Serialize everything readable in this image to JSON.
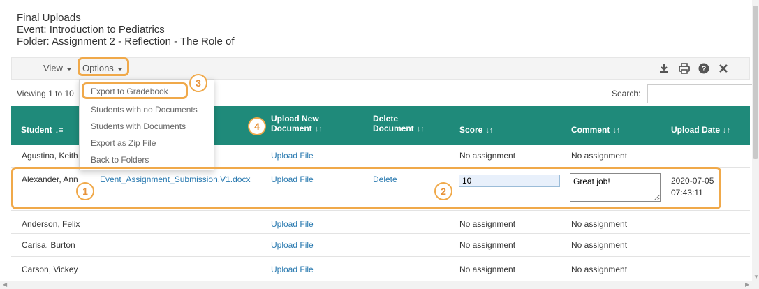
{
  "header": {
    "title": "Final Uploads",
    "event": "Event: Introduction to Pediatrics",
    "folder": "Folder: Assignment 2 - Reflection - The Role of"
  },
  "toolbar": {
    "view_label": "View",
    "options_label": "Options",
    "icons": [
      "download-icon",
      "print-icon",
      "help-icon",
      "close-icon"
    ]
  },
  "options_menu": {
    "items": [
      "Export to Gradebook",
      "Students with no Documents",
      "Students with Documents",
      "Export as Zip File",
      "Back to Folders"
    ]
  },
  "viewing_text": "Viewing 1 to 10",
  "search": {
    "label": "Search:",
    "value": ""
  },
  "columns": {
    "student": "Student",
    "upload_new_1": "Upload New",
    "upload_new_2": "Document",
    "delete_1": "Delete",
    "delete_2": "Document",
    "score": "Score",
    "comment": "Comment",
    "upload_date": "Upload Date"
  },
  "rows": [
    {
      "student": "Agustina, Keith",
      "upload": "Upload File",
      "score": "No assignment",
      "comment": "No assignment"
    },
    {
      "student": "Alexander, Ann",
      "document": "Event_Assignment_Submission.V1.docx",
      "upload": "Upload File",
      "delete": "Delete",
      "score": "10",
      "comment": "Great job!",
      "date": "2020-07-05",
      "time": "07:43:11"
    },
    {
      "student": "Anderson, Felix",
      "upload": "Upload File",
      "score": "No assignment",
      "comment": "No assignment"
    },
    {
      "student": "Carisa, Burton",
      "upload": "Upload File",
      "score": "No assignment",
      "comment": "No assignment"
    },
    {
      "student": "Carson, Vickey",
      "upload": "Upload File",
      "score": "No assignment",
      "comment": "No assignment"
    }
  ],
  "callouts": [
    "1",
    "2",
    "3",
    "4"
  ],
  "colors": {
    "header_bg": "#1f8a7a",
    "link": "#2a7ab0",
    "highlight": "#f0a94a"
  }
}
